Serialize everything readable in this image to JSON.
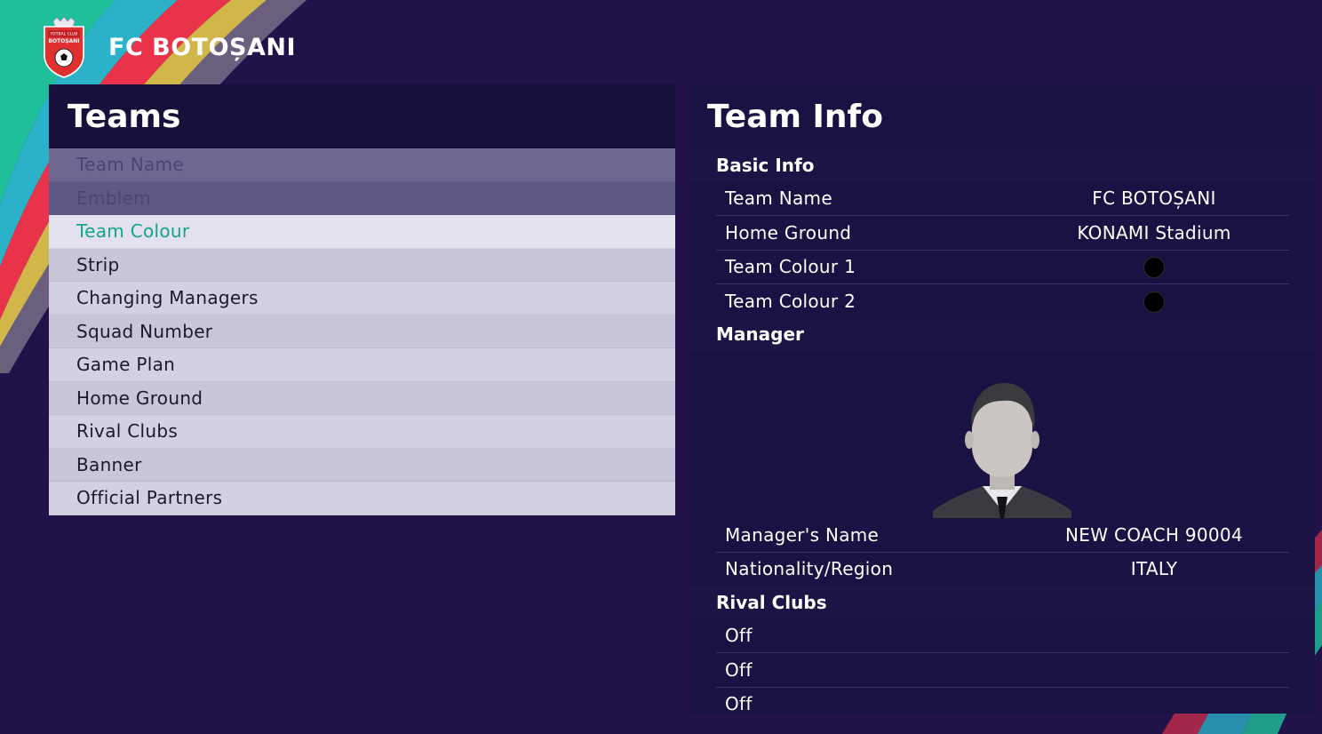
{
  "header": {
    "club_name": "FC BOTOȘANI",
    "crest_icon": "club-crest-icon",
    "crest_text_top": "FOTBAL CLUB",
    "crest_text_bottom": "BOTOȘANI"
  },
  "teams_panel": {
    "title": "Teams",
    "items": [
      {
        "label": "Team Name",
        "state": "disabled"
      },
      {
        "label": "Emblem",
        "state": "disabled"
      },
      {
        "label": "Team Colour",
        "state": "selected"
      },
      {
        "label": "Strip",
        "state": "normal"
      },
      {
        "label": "Changing Managers",
        "state": "normal"
      },
      {
        "label": "Squad Number",
        "state": "normal"
      },
      {
        "label": "Game Plan",
        "state": "normal"
      },
      {
        "label": "Home Ground",
        "state": "normal"
      },
      {
        "label": "Rival Clubs",
        "state": "normal"
      },
      {
        "label": "Banner",
        "state": "normal"
      },
      {
        "label": "Official Partners",
        "state": "normal"
      }
    ]
  },
  "team_info": {
    "title": "Team Info",
    "basic_info": {
      "title": "Basic Info",
      "team_name_label": "Team Name",
      "team_name_value": "FC BOTOȘANI",
      "home_ground_label": "Home Ground",
      "home_ground_value": "KONAMI Stadium",
      "team_colour_1_label": "Team Colour 1",
      "team_colour_1_value": "#000000",
      "team_colour_2_label": "Team Colour 2",
      "team_colour_2_value": "#000000"
    },
    "manager": {
      "title": "Manager",
      "portrait_icon": "manager-silhouette-icon",
      "name_label": "Manager's Name",
      "name_value": "NEW COACH 90004",
      "nationality_label": "Nationality/Region",
      "nationality_value": "ITALY"
    },
    "rival_clubs": {
      "title": "Rival Clubs",
      "values": [
        "Off",
        "Off",
        "Off"
      ]
    }
  },
  "colors": {
    "background": "#21124a",
    "panel_header": "#17103a",
    "selected_text": "#13a389",
    "menu_light": "#d3d1e1",
    "menu_dark": "#c8c6d8"
  }
}
